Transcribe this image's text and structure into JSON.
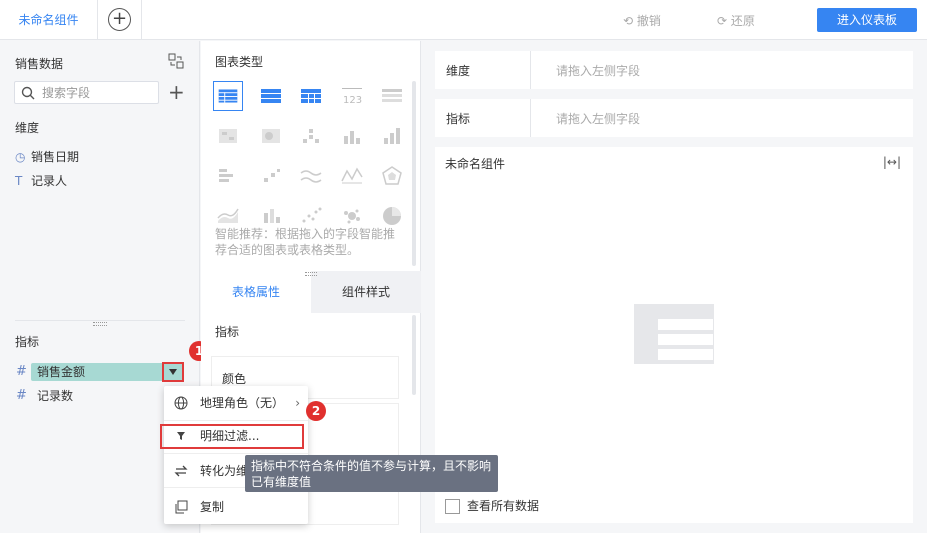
{
  "topbar": {
    "tab_label": "未命名组件",
    "add_tab": "+",
    "undo_label": "撤销",
    "redo_label": "还原",
    "enter_dashboard_label": "进入仪表板"
  },
  "left_panel": {
    "dataset_title": "销售数据",
    "search_placeholder": "搜索字段",
    "add": "+",
    "dimension_label": "维度",
    "dimensions": [
      {
        "icon": "clock-icon",
        "label": "销售日期"
      },
      {
        "icon": "text-type-icon",
        "label": "记录人"
      }
    ],
    "measure_label": "指标",
    "measures": [
      {
        "icon": "hash-icon",
        "label": "销售金额"
      },
      {
        "icon": "hash-icon",
        "label": "记录数"
      }
    ]
  },
  "middle_panel": {
    "chart_type_title": "图表类型",
    "recommend_text": "智能推荐：根据拖入的字段智能推荐合适的图表或表格类型。",
    "tabs": [
      "表格属性",
      "组件样式"
    ],
    "section_label": "指标",
    "color_label": "颜色"
  },
  "right_panel": {
    "dimension_slot": {
      "label": "维度",
      "placeholder": "请拖入左侧字段"
    },
    "measure_slot": {
      "label": "指标",
      "placeholder": "请拖入左侧字段"
    },
    "canvas_title": "未命名组件",
    "view_all_label": "查看所有数据"
  },
  "context_menu": {
    "items": [
      {
        "icon": "globe-icon",
        "label": "地理角色（无）"
      },
      {
        "icon": "filter-icon",
        "label": "明细过滤..."
      },
      {
        "icon": "swap-icon",
        "label": "转化为维度"
      },
      {
        "icon": "copy-icon",
        "label": "复制"
      }
    ]
  },
  "tooltip": {
    "text": "指标中不符合条件的值不参与计算，且不影响已有维度值"
  },
  "annotations": {
    "badge1": "1",
    "badge2": "2"
  },
  "colors": {
    "accent": "#3685f2",
    "pill": "#a7d9d3",
    "highlight": "#e03b3b",
    "tooltip_bg": "#6a7181"
  }
}
